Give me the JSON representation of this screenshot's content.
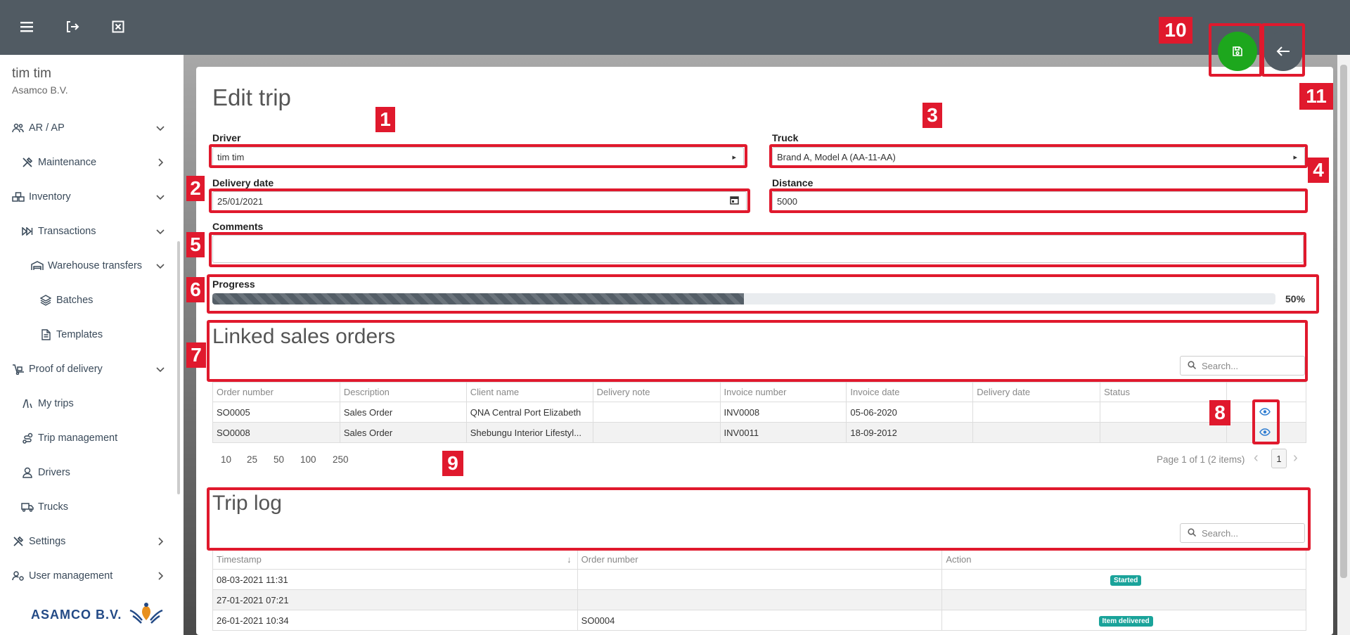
{
  "sidebar": {
    "user_name": "tim tim",
    "company": "Asamco B.V.",
    "items": [
      {
        "label": "AR / AP",
        "icon": "users-icon",
        "chevron": "down"
      },
      {
        "label": "Maintenance",
        "icon": "tools-icon",
        "chevron": "right"
      },
      {
        "label": "Inventory",
        "icon": "boxes-icon",
        "chevron": "down"
      },
      {
        "label": "Transactions",
        "icon": "fast-forward-icon",
        "chevron": "down"
      },
      {
        "label": "Warehouse transfers",
        "icon": "warehouse-icon",
        "chevron": "down"
      },
      {
        "label": "Batches",
        "icon": "layers-icon",
        "chevron": ""
      },
      {
        "label": "Templates",
        "icon": "document-icon",
        "chevron": ""
      },
      {
        "label": "Proof of delivery",
        "icon": "dolly-icon",
        "chevron": "down"
      },
      {
        "label": "My trips",
        "icon": "route-icon",
        "chevron": ""
      },
      {
        "label": "Trip management",
        "icon": "route-pin-icon",
        "chevron": ""
      },
      {
        "label": "Drivers",
        "icon": "person-icon",
        "chevron": ""
      },
      {
        "label": "Trucks",
        "icon": "truck-icon",
        "chevron": ""
      },
      {
        "label": "Settings",
        "icon": "wrench-icon",
        "chevron": "right"
      },
      {
        "label": "User management",
        "icon": "users-gear-icon",
        "chevron": "right"
      }
    ],
    "logo_text": "ASAMCO B.V."
  },
  "form": {
    "title": "Edit trip",
    "driver_label": "Driver",
    "driver_value": "tim tim",
    "truck_label": "Truck",
    "truck_value": "Brand A, Model A (AA-11-AA)",
    "delivery_date_label": "Delivery date",
    "delivery_date_value": "25/01/2021",
    "distance_label": "Distance",
    "distance_value": "5000",
    "comments_label": "Comments",
    "comments_value": "",
    "progress_label": "Progress",
    "progress_percent": 50,
    "progress_text": "50%"
  },
  "sales_orders": {
    "title": "Linked sales orders",
    "search_placeholder": "Search...",
    "columns": [
      "Order number",
      "Description",
      "Client name",
      "Delivery note",
      "Invoice number",
      "Invoice date",
      "Delivery date",
      "Status",
      ""
    ],
    "rows": [
      [
        "SO0005",
        "Sales Order",
        "QNA Central Port Elizabeth",
        "",
        "INV0008",
        "05-06-2020",
        "",
        ""
      ],
      [
        "SO0008",
        "Sales Order",
        "Shebungu Interior Lifestyl...",
        "",
        "INV0011",
        "18-09-2012",
        "",
        ""
      ]
    ],
    "page_sizes": [
      "10",
      "25",
      "50",
      "100",
      "250"
    ],
    "page_info": "Page 1 of 1 (2 items)",
    "current_page": "1"
  },
  "trip_log": {
    "title": "Trip log",
    "search_placeholder": "Search...",
    "columns": [
      "Timestamp",
      "Order number",
      "Action"
    ],
    "rows": [
      [
        "08-03-2021 11:31",
        "",
        "Started"
      ],
      [
        "27-01-2021 07:21",
        "",
        ""
      ],
      [
        "26-01-2021 10:34",
        "SO0004",
        "Item delivered"
      ]
    ]
  },
  "annotations": [
    "1",
    "2",
    "3",
    "4",
    "5",
    "6",
    "7",
    "8",
    "9",
    "10",
    "11"
  ],
  "colors": {
    "topbar": "#515b63",
    "save": "#1da71d",
    "back": "#515b63",
    "annotation": "#e0192d",
    "badge": "#1aa39a"
  }
}
